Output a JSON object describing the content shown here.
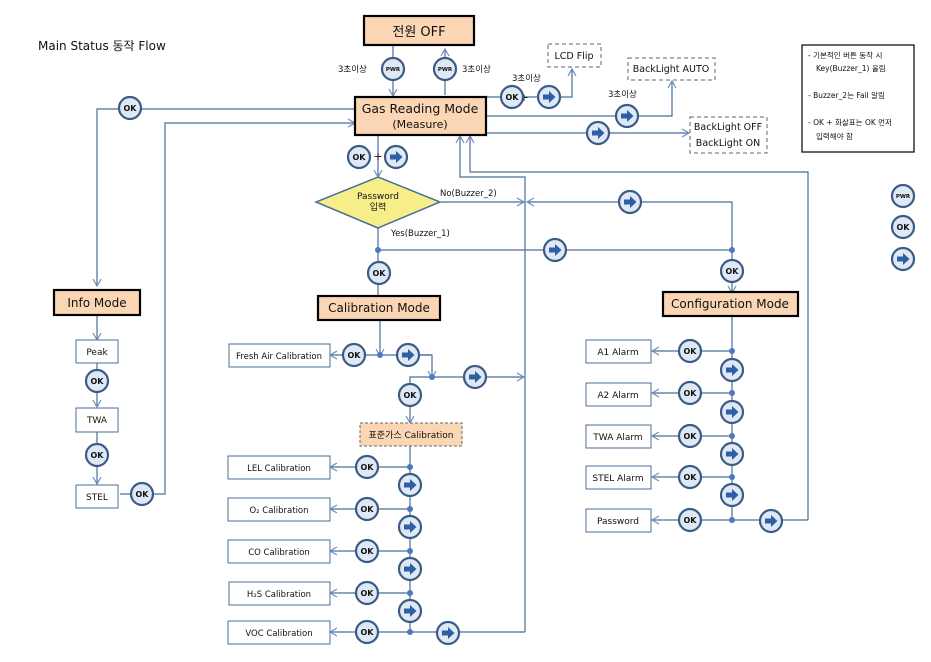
{
  "title": "Main Status 동작 Flow",
  "modes": {
    "power_off": "전원 OFF",
    "gas_reading": "Gas Reading Mode",
    "gas_reading_sub": "(Measure)",
    "info": "Info Mode",
    "calibration": "Calibration Mode",
    "configuration": "Configuration Mode",
    "std_gas_calibration": "표준가스  Calibration"
  },
  "decision": {
    "label_line1": "Password",
    "label_line2": "입력",
    "no_label": "No(Buzzer_2)",
    "yes_label": "Yes(Buzzer_1)"
  },
  "hold_labels": {
    "pwr_off": "3초이상",
    "pwr_on": "3초이상",
    "lcd_flip": "3초이상",
    "backlight_auto": "3초이상"
  },
  "plus": "+",
  "options": {
    "lcd_flip": "LCD Flip",
    "backlight_auto": "BackLight AUTO",
    "backlight_off": "BackLight OFF",
    "backlight_on": "BackLight ON"
  },
  "info_items": [
    "Peak",
    "TWA",
    "STEL"
  ],
  "calibration_items": {
    "fresh_air": "Fresh Air Calibration",
    "gases": [
      "LEL Calibration",
      "O₂ Calibration",
      "CO Calibration",
      "H₂S Calibration",
      "VOC Calibration"
    ]
  },
  "configuration_items": [
    "A1 Alarm",
    "A2 Alarm",
    "TWA Alarm",
    "STEL Alarm",
    "Password"
  ],
  "buttons": {
    "pwr": "PWR",
    "ok": "OK",
    "arrow": "➡"
  },
  "legend_notes": [
    "- 기본적인 버튼 동작 시",
    "Key(Buzzer_1) 울림",
    "- Buzzer_2는 Fail 알림",
    "- OK + 화살표는 OK 먼저",
    "입력해야 함"
  ],
  "colors": {
    "mode_fill": "#fbd6b4",
    "decision_fill": "#f7ee8a",
    "button_fill": "#dfe9f6",
    "button_stroke": "#3b5b85",
    "line": "#4a6f9a",
    "arrow_icon": "#2f5fa3"
  }
}
